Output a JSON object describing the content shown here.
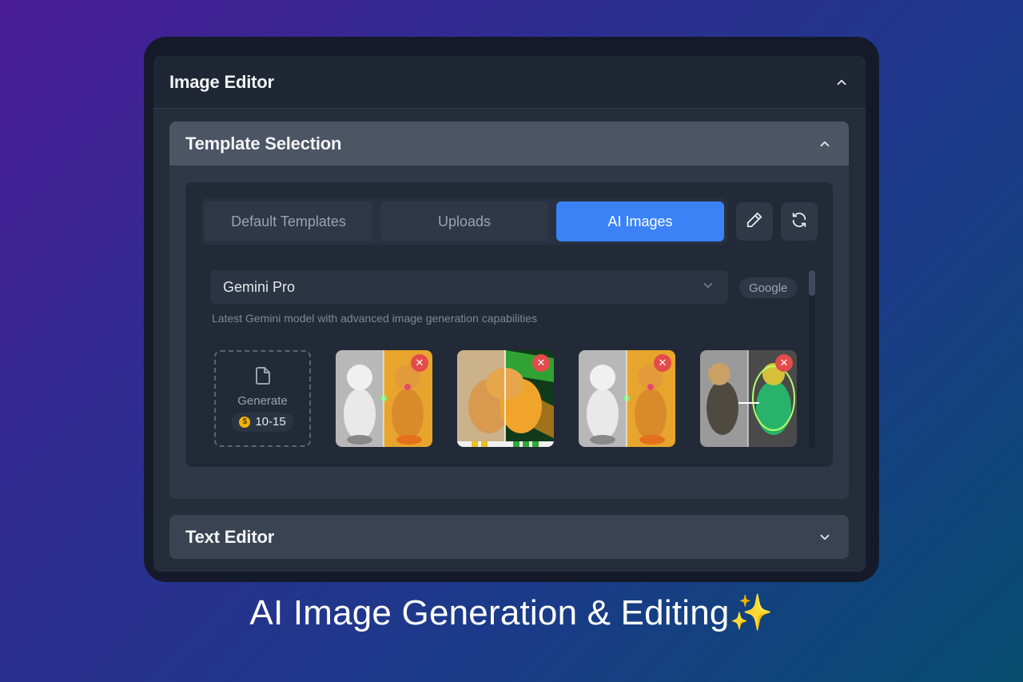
{
  "panel": {
    "title": "Image Editor"
  },
  "template_section": {
    "title": "Template Selection"
  },
  "tabs": [
    {
      "label": "Default Templates",
      "active": false
    },
    {
      "label": "Uploads",
      "active": false
    },
    {
      "label": "AI Images",
      "active": true
    }
  ],
  "actions": {
    "edit_icon": "pencil-icon",
    "refresh_icon": "refresh-icon"
  },
  "model": {
    "selected": "Gemini Pro",
    "provider": "Google",
    "description": "Latest Gemini model with advanced image generation capabilities"
  },
  "generate": {
    "label": "Generate",
    "cost": "10-15"
  },
  "text_section": {
    "title": "Text Editor"
  },
  "caption": "AI Image Generation & Editing✨",
  "colors": {
    "accent": "#3b82f6",
    "danger": "#e34b4b",
    "coin": "#f5b301"
  }
}
